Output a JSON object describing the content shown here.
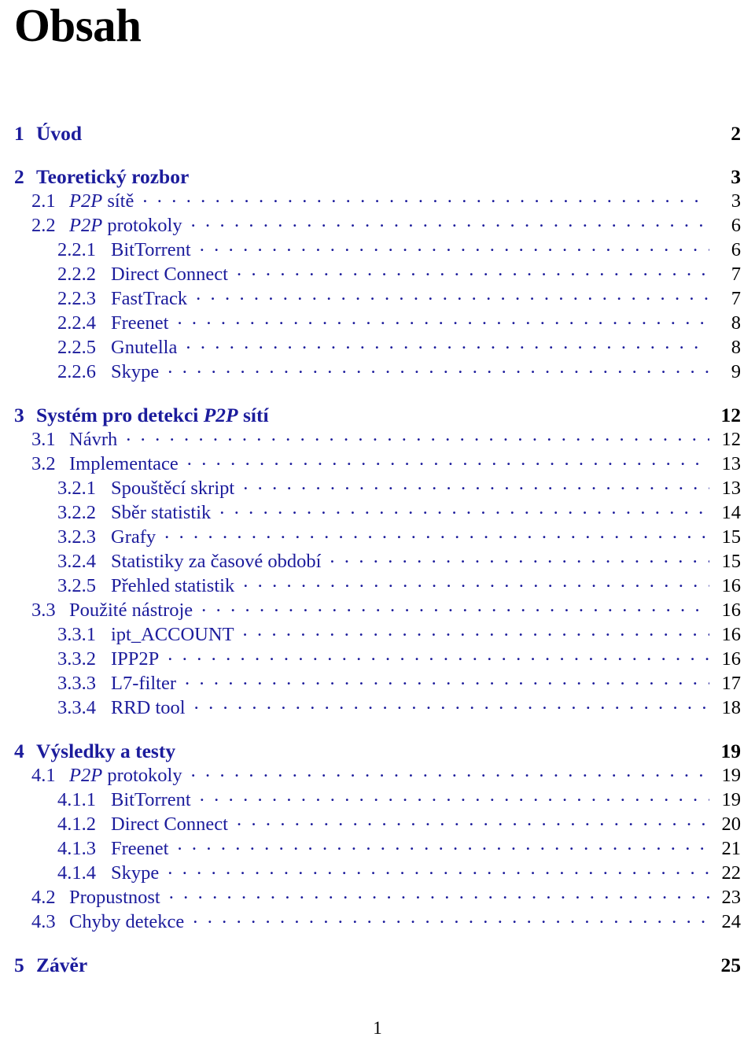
{
  "document": {
    "title": "Obsah",
    "footer_page_number": "1",
    "accent_color": "#1c1c9c",
    "page_number_color": "#000000",
    "title_color": "#000000"
  },
  "toc": {
    "entries": [
      {
        "level": "chapter",
        "number": "1",
        "text": "Úvod",
        "page": "2"
      },
      {
        "level": "chapter",
        "number": "2",
        "text": "Teoretický rozbor",
        "page": "3"
      },
      {
        "level": "section",
        "number": "2.1",
        "text": "P2P sítě",
        "italic_prefix": "P2P",
        "rest": " sítě",
        "page": "3"
      },
      {
        "level": "section",
        "number": "2.2",
        "text": "P2P protokoly",
        "italic_prefix": "P2P",
        "rest": " protokoly",
        "page": "6"
      },
      {
        "level": "subsection",
        "number": "2.2.1",
        "text": "BitTorrent",
        "page": "6"
      },
      {
        "level": "subsection",
        "number": "2.2.2",
        "text": "Direct Connect",
        "page": "7"
      },
      {
        "level": "subsection",
        "number": "2.2.3",
        "text": "FastTrack",
        "page": "7"
      },
      {
        "level": "subsection",
        "number": "2.2.4",
        "text": "Freenet",
        "page": "8"
      },
      {
        "level": "subsection",
        "number": "2.2.5",
        "text": "Gnutella",
        "page": "8"
      },
      {
        "level": "subsection",
        "number": "2.2.6",
        "text": "Skype",
        "page": "9"
      },
      {
        "level": "chapter",
        "number": "3",
        "text": "Systém pro detekci P2P sítí",
        "italic_word": "P2P",
        "page": "12"
      },
      {
        "level": "section",
        "number": "3.1",
        "text": "Návrh",
        "page": "12"
      },
      {
        "level": "section",
        "number": "3.2",
        "text": "Implementace",
        "page": "13"
      },
      {
        "level": "subsection",
        "number": "3.2.1",
        "text": "Spouštěcí skript",
        "page": "13"
      },
      {
        "level": "subsection",
        "number": "3.2.2",
        "text": "Sběr statistik",
        "page": "14"
      },
      {
        "level": "subsection",
        "number": "3.2.3",
        "text": "Grafy",
        "page": "15"
      },
      {
        "level": "subsection",
        "number": "3.2.4",
        "text": "Statistiky za časové období",
        "page": "15"
      },
      {
        "level": "subsection",
        "number": "3.2.5",
        "text": "Přehled statistik",
        "page": "16"
      },
      {
        "level": "section",
        "number": "3.3",
        "text": "Použité nástroje",
        "page": "16"
      },
      {
        "level": "subsection",
        "number": "3.3.1",
        "text": "ipt_ACCOUNT",
        "page": "16"
      },
      {
        "level": "subsection",
        "number": "3.3.2",
        "text": "IPP2P",
        "page": "16"
      },
      {
        "level": "subsection",
        "number": "3.3.3",
        "text": "L7-filter",
        "page": "17"
      },
      {
        "level": "subsection",
        "number": "3.3.4",
        "text": "RRD tool",
        "page": "18"
      },
      {
        "level": "chapter",
        "number": "4",
        "text": "Výsledky a testy",
        "page": "19"
      },
      {
        "level": "section",
        "number": "4.1",
        "text": "P2P protokoly",
        "italic_prefix": "P2P",
        "rest": " protokoly",
        "page": "19"
      },
      {
        "level": "subsection",
        "number": "4.1.1",
        "text": "BitTorrent",
        "page": "19"
      },
      {
        "level": "subsection",
        "number": "4.1.2",
        "text": "Direct Connect",
        "page": "20"
      },
      {
        "level": "subsection",
        "number": "4.1.3",
        "text": "Freenet",
        "page": "21"
      },
      {
        "level": "subsection",
        "number": "4.1.4",
        "text": "Skype",
        "page": "22"
      },
      {
        "level": "section",
        "number": "4.2",
        "text": "Propustnost",
        "page": "23"
      },
      {
        "level": "section",
        "number": "4.3",
        "text": "Chyby detekce",
        "page": "24"
      },
      {
        "level": "chapter",
        "number": "5",
        "text": "Závěr",
        "page": "25"
      }
    ]
  }
}
